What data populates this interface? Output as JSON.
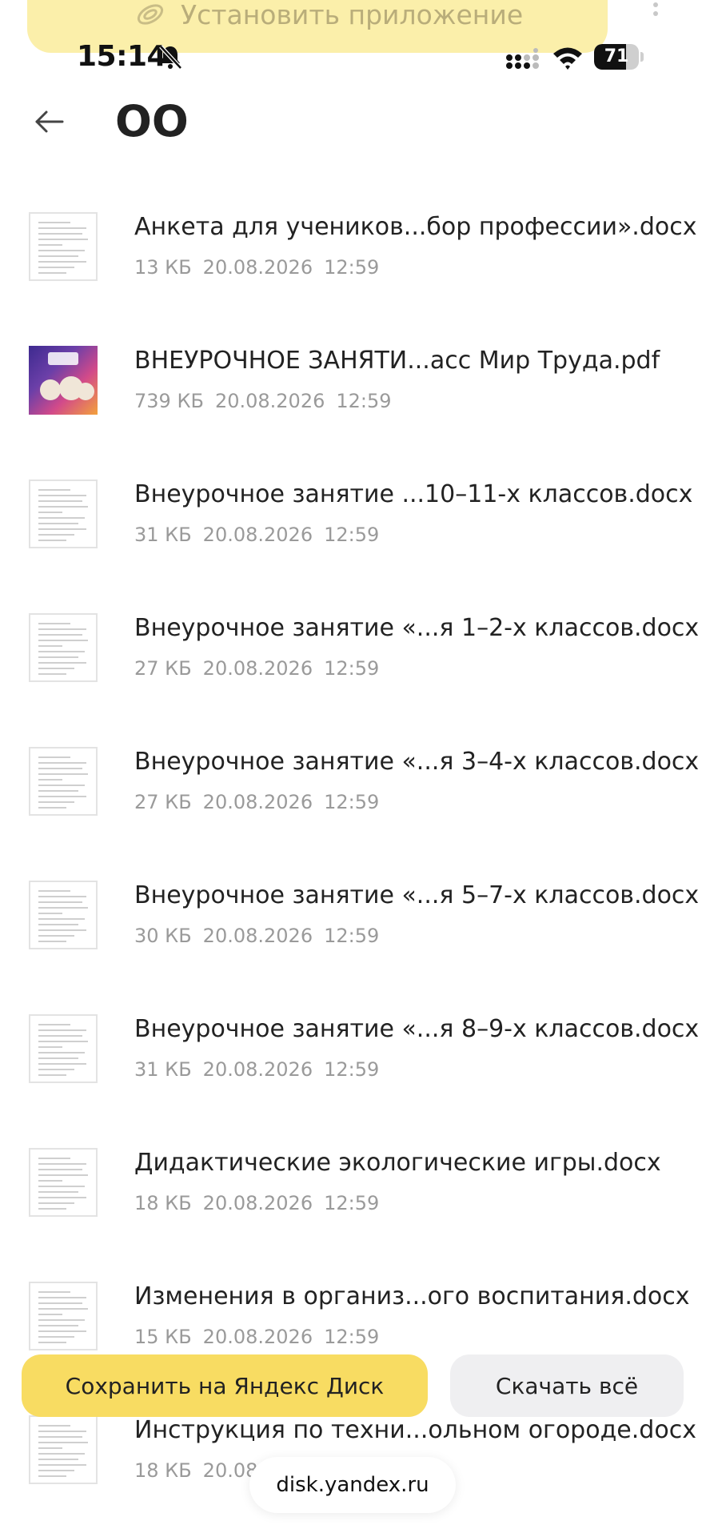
{
  "banner": {
    "install_label": "Установить приложение"
  },
  "status_bar": {
    "time": "15:14",
    "battery_percent": "71",
    "battery_level": 0.71
  },
  "header": {
    "title": "ОО"
  },
  "files": [
    {
      "name": "Анкета для учеников...бор профессии».docx",
      "size": "13 КБ",
      "date": "20.08.2026",
      "time": "12:59",
      "thumb": "docx"
    },
    {
      "name": "ВНЕУРОЧНОЕ ЗАНЯТИ...асс Мир Труда.pdf",
      "size": "739 КБ",
      "date": "20.08.2026",
      "time": "12:59",
      "thumb": "pdf"
    },
    {
      "name": "Внеурочное занятие ...10–11-х классов.docx",
      "size": "31 КБ",
      "date": "20.08.2026",
      "time": "12:59",
      "thumb": "docx"
    },
    {
      "name": "Внеурочное занятие «...я 1–2-х классов.docx",
      "size": "27 КБ",
      "date": "20.08.2026",
      "time": "12:59",
      "thumb": "docx"
    },
    {
      "name": "Внеурочное занятие «...я 3–4-х классов.docx",
      "size": "27 КБ",
      "date": "20.08.2026",
      "time": "12:59",
      "thumb": "docx"
    },
    {
      "name": "Внеурочное занятие «...я 5–7-х классов.docx",
      "size": "30 КБ",
      "date": "20.08.2026",
      "time": "12:59",
      "thumb": "docx"
    },
    {
      "name": "Внеурочное занятие «...я 8–9-х классов.docx",
      "size": "31 КБ",
      "date": "20.08.2026",
      "time": "12:59",
      "thumb": "docx"
    },
    {
      "name": "Дидактические экологические игры.docx",
      "size": "18 КБ",
      "date": "20.08.2026",
      "time": "12:59",
      "thumb": "docx"
    },
    {
      "name": "Изменения в организ...ого воспитания.docx",
      "size": "15 КБ",
      "date": "20.08.2026",
      "time": "12:59",
      "thumb": "docx"
    },
    {
      "name": "Инструкция по техни...ольном огороде.docx",
      "size": "18 КБ",
      "date": "20.08",
      "time": "",
      "thumb": "docx"
    }
  ],
  "actions": {
    "save_label": "Сохранить на Яндекс Диск",
    "download_label": "Скачать всё"
  },
  "browser": {
    "url": "disk.yandex.ru"
  },
  "colors": {
    "accent_yellow": "#f8dc62",
    "banner_yellow": "#fbefaa",
    "secondary_button": "#efeff1",
    "meta_gray": "#9a9a9a"
  }
}
